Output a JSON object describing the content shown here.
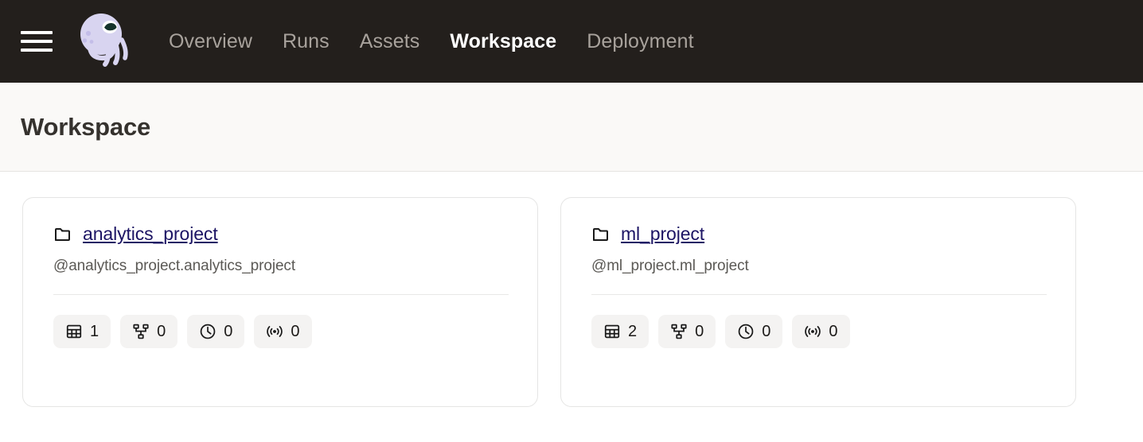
{
  "topnav": {
    "menu_icon": "hamburger-menu-icon",
    "logo_icon": "dagster-octopus-logo",
    "items": [
      {
        "label": "Overview",
        "active": false
      },
      {
        "label": "Runs",
        "active": false
      },
      {
        "label": "Assets",
        "active": false
      },
      {
        "label": "Workspace",
        "active": true
      },
      {
        "label": "Deployment",
        "active": false
      }
    ]
  },
  "page": {
    "title": "Workspace"
  },
  "colors": {
    "nav_background": "#231f1c",
    "nav_item_inactive": "#a8a29c",
    "nav_item_active": "#ffffff",
    "page_header_background": "#faf9f7",
    "link": "#1c1464",
    "badge_background": "#f4f3f2",
    "card_border": "#e5e5e4",
    "logo_body": "#d8d4f0"
  },
  "cards": [
    {
      "folder_icon": "folder-icon",
      "title": "analytics_project",
      "subtitle": "@analytics_project.analytics_project",
      "stats": [
        {
          "icon": "assets-table-icon",
          "name": "assets",
          "count": "1"
        },
        {
          "icon": "jobs-graph-icon",
          "name": "jobs",
          "count": "0"
        },
        {
          "icon": "schedules-clock-icon",
          "name": "schedules",
          "count": "0"
        },
        {
          "icon": "sensors-broadcast-icon",
          "name": "sensors",
          "count": "0"
        }
      ]
    },
    {
      "folder_icon": "folder-icon",
      "title": "ml_project",
      "subtitle": "@ml_project.ml_project",
      "stats": [
        {
          "icon": "assets-table-icon",
          "name": "assets",
          "count": "2"
        },
        {
          "icon": "jobs-graph-icon",
          "name": "jobs",
          "count": "0"
        },
        {
          "icon": "schedules-clock-icon",
          "name": "schedules",
          "count": "0"
        },
        {
          "icon": "sensors-broadcast-icon",
          "name": "sensors",
          "count": "0"
        }
      ]
    }
  ]
}
